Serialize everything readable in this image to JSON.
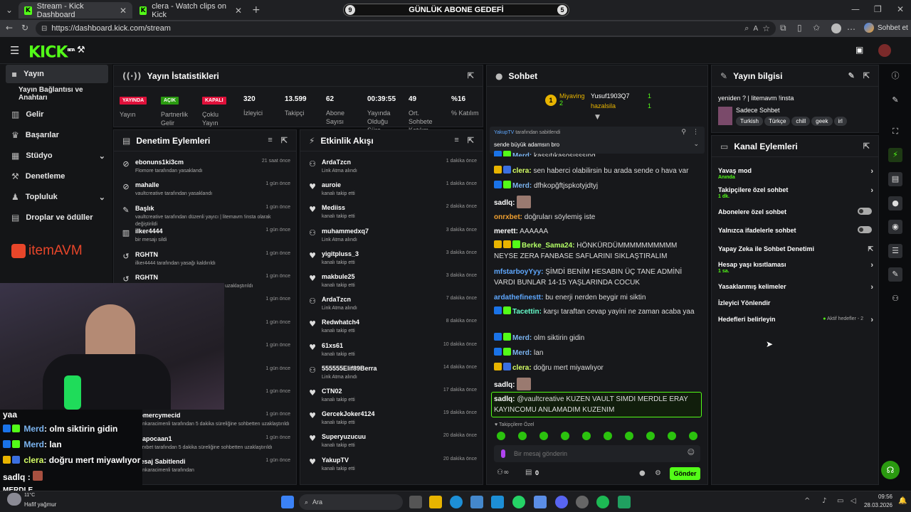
{
  "browser": {
    "tabs": [
      {
        "title": "Stream - Kick Dashboard",
        "active": true
      },
      {
        "title": "clera - Watch clips on Kick",
        "active": false
      }
    ],
    "url": "https://dashboard.kick.com/stream",
    "profile_button": "Sohbet et",
    "goal": {
      "label": "GÜNLÜK ABONE GEDEFİ",
      "left": "9",
      "right": "5"
    }
  },
  "colors": {
    "accent": "#53fc18",
    "live": "#e0103a",
    "bg": "#0b0c0e",
    "panel": "#17181b"
  },
  "topbar": {
    "logo": "KICK",
    "logo_sup": "BETA"
  },
  "sidebar": {
    "items": [
      {
        "label": "Yayın",
        "icon": "broadcast-icon"
      },
      {
        "label": "Yayın Bağlantısı ve Anahtarı",
        "icon": ""
      },
      {
        "label": "Gelir",
        "icon": "chart-icon"
      },
      {
        "label": "Başarılar",
        "icon": "trophy-icon"
      },
      {
        "label": "Stüdyo",
        "icon": "studio-icon"
      },
      {
        "label": "Denetleme",
        "icon": "hammer-icon"
      },
      {
        "label": "Topluluk",
        "icon": "community-icon"
      },
      {
        "label": "Droplar ve ödüller",
        "icon": "gift-icon"
      }
    ],
    "sponsor": "itemAVM"
  },
  "stats": {
    "title": "Yayın İstatistikleri",
    "items": [
      {
        "value": "YAYINDA",
        "label": "Yayın",
        "type": "badge-red"
      },
      {
        "value": "AÇIK",
        "label": "Partnerlik Gelir",
        "type": "badge-green"
      },
      {
        "value": "KAPALI",
        "label": "Çoklu Yayın",
        "type": "badge-red"
      },
      {
        "value": "320",
        "label": "İzleyici"
      },
      {
        "value": "13.599",
        "label": "Takipçi"
      },
      {
        "value": "62",
        "label": "Abone Sayısı"
      },
      {
        "value": "00:39:55",
        "label": "Yayında Olduğu Süre"
      },
      {
        "value": "49",
        "label": "Ort. Sohbete Katılım"
      },
      {
        "value": "%16",
        "label": "% Katılım"
      }
    ]
  },
  "moderation": {
    "title": "Denetim Eylemleri",
    "rows": [
      {
        "icon": "ban-icon",
        "name": "ebonuns1ki3cm",
        "sub": "Flomore tarafından yasaklandı",
        "time": "21 saat önce"
      },
      {
        "icon": "ban-icon",
        "name": "mahalle",
        "sub": "vaultcreative tarafından yasaklandı",
        "time": "1 gün önce"
      },
      {
        "icon": "edit-icon",
        "name": "Başlık",
        "sub": "vaultcreative tarafından düzenli yayıcı | litemavm !insta olarak değiştirildi",
        "time": "1 gün önce"
      },
      {
        "icon": "trash-icon",
        "name": "ilker4444",
        "sub": "bir mesajı sildi",
        "time": "1 gün önce"
      },
      {
        "icon": "undo-icon",
        "name": "RGHTN",
        "sub": "ilker4444 tarafından yasağı kaldırıldı",
        "time": "1 gün önce"
      },
      {
        "icon": "undo-icon",
        "name": "RGHTN",
        "sub": "tarafından 5 dakika süreliğine sohbetten uzaklaştırıldı",
        "time": "1 gün önce"
      },
      {
        "icon": "",
        "name": "",
        "sub": "sohbetten uzaklaştırıldı",
        "time": "1 gün önce"
      },
      {
        "icon": "",
        "name": "",
        "sub": "",
        "time": "1 gün önce"
      },
      {
        "icon": "",
        "name": "",
        "sub": "sohbetten uzaklaştırıldı",
        "time": "1 gün önce"
      },
      {
        "icon": "",
        "name": "",
        "sub": "",
        "time": "1 gün önce"
      },
      {
        "icon": "",
        "name": "",
        "sub": "lldı",
        "time": "1 gün önce"
      },
      {
        "icon": "hourglass-icon",
        "name": "nomercymecid",
        "sub": "erenkaracimenli tarafından 5 dakika süreliğine sohbetten uzaklaştırıldı",
        "time": "1 gün önce"
      },
      {
        "icon": "hourglass-icon",
        "name": "aaapocaan1",
        "sub": "omrxbet tarafından 5 dakika süreliğine sohbetten uzaklaştırıldı",
        "time": "1 gün önce"
      },
      {
        "icon": "pin-icon",
        "name": "Mesaj Sabitlendi",
        "sub": "erenkaracimenli tarafından",
        "time": "1 gün önce"
      }
    ]
  },
  "activity": {
    "title": "Etkinlik Akışı",
    "rows": [
      {
        "icon": "gift-icon",
        "name": "ArdaTzcn",
        "sub": "Link Atma alındı",
        "time": "1 dakika önce",
        "green": true
      },
      {
        "icon": "heart-icon",
        "name": "auroie",
        "sub": "kanalı takip etti",
        "time": "1 dakika önce"
      },
      {
        "icon": "heart-icon",
        "name": "Mediiss",
        "sub": "kanalı takip etti",
        "time": "2 dakika önce"
      },
      {
        "icon": "gift-icon",
        "name": "muhammedxq7",
        "sub": "Link Atma alındı",
        "time": "3 dakika önce",
        "green": true
      },
      {
        "icon": "heart-icon",
        "name": "yigitpluss_3",
        "sub": "kanalı takip etti",
        "time": "3 dakika önce"
      },
      {
        "icon": "heart-icon",
        "name": "makbule25",
        "sub": "kanalı takip etti",
        "time": "3 dakika önce"
      },
      {
        "icon": "gift-icon",
        "name": "ArdaTzcn",
        "sub": "Link Atma alındı",
        "time": "7 dakika önce",
        "green": true
      },
      {
        "icon": "heart-icon",
        "name": "Redwhatch4",
        "sub": "kanalı takip etti",
        "time": "8 dakika önce"
      },
      {
        "icon": "heart-icon",
        "name": "61xs61",
        "sub": "kanalı takip etti",
        "time": "10 dakika önce"
      },
      {
        "icon": "gift-icon",
        "name": "555555Elif89Berra",
        "sub": "Link Atma alındı",
        "time": "14 dakika önce",
        "green": true
      },
      {
        "icon": "heart-icon",
        "name": "CTN02",
        "sub": "kanalı takip etti",
        "time": "17 dakika önce"
      },
      {
        "icon": "heart-icon",
        "name": "GercekJoker4124",
        "sub": "kanalı takip etti",
        "time": "19 dakika önce"
      },
      {
        "icon": "heart-icon",
        "name": "Superyuzucuu",
        "sub": "kanalı takip etti",
        "time": "20 dakika önce"
      },
      {
        "icon": "heart-icon",
        "name": "YakupTV",
        "sub": "kanalı takip etti",
        "time": "20 dakika önce"
      }
    ]
  },
  "chat": {
    "title": "Sohbet",
    "leaderboard": [
      {
        "name": "Miyaving",
        "count": "2"
      },
      {
        "name": "Yusuf1903Q7",
        "count": "1"
      },
      {
        "name": "hazalsila",
        "count": "1"
      }
    ],
    "pinned": {
      "by": "YakupTV",
      "by_suffix": "tarafından sabitlendi",
      "text": "sende büyük adamsın bro"
    },
    "messages": [
      {
        "user": "Merd",
        "color": "#7bb4f0",
        "text": "kaşşıtıkasoşışşşıng",
        "badges": [
          "#1a73e8",
          "#53fc18"
        ]
      },
      {
        "user": "clera",
        "color": "#d6ff66",
        "text": "sen haberci olabilirsin bu arada sende o hava var",
        "badges": [
          "#e8b400",
          "#3b6fe0"
        ]
      },
      {
        "user": "Merd",
        "color": "#7bb4f0",
        "text": "dfhkopğftjspkotyjdtyj",
        "badges": [
          "#1a73e8",
          "#53fc18"
        ]
      },
      {
        "user": "sadlq",
        "color": "#ffffff",
        "text": "",
        "badges": []
      },
      {
        "user": "onrxbet",
        "color": "#f0a030",
        "text": "doğruları söylemiş iste",
        "badges": []
      },
      {
        "user": "merett",
        "color": "#ffffff",
        "text": "AAAAAA",
        "badges": []
      },
      {
        "user": "Berke_Sama24",
        "color": "#b4ff66",
        "text": "HÖNKÜRDÜMMMMMMMMMM NEYSE ZERA FANBASE SAFLARINI SIKLAŞTIRALIM",
        "badges": [
          "#e8b400",
          "#e8b400",
          "#53fc18"
        ]
      },
      {
        "user": "mfstarboyYyy",
        "color": "#5fa8ff",
        "text": "ŞİMDİ BENİM HESABIN ÜÇ TANE ADMİNİ VARDI BUNLAR 14-15 YAŞLARINDA COCUK",
        "badges": []
      },
      {
        "user": "ardathefinestt",
        "color": "#5fa8ff",
        "text": "bu enerji nerden beygir mi siktin",
        "badges": []
      },
      {
        "user": "Tacettin",
        "color": "#66ffcc",
        "text": "karşı taraftan cevap yayini ne zaman acaba yaa",
        "badges": [
          "#1a73e8",
          "#53fc18"
        ]
      },
      {
        "user": "Merd",
        "color": "#7bb4f0",
        "text": "olm siktirin gidin",
        "badges": [
          "#1a73e8",
          "#53fc18"
        ]
      },
      {
        "user": "Merd",
        "color": "#7bb4f0",
        "text": "lan",
        "badges": [
          "#1a73e8",
          "#53fc18"
        ]
      },
      {
        "user": "clera",
        "color": "#d6ff66",
        "text": "doğru mert miyawlıyor",
        "badges": [
          "#e8b400",
          "#3b6fe0"
        ]
      },
      {
        "user": "sadlq",
        "color": "#ffffff",
        "text": "",
        "badges": []
      },
      {
        "user": "sadlq",
        "color": "#ffffff",
        "text": "@vaultcreative KUZEN VAULT SIMDI MERDLE ERAY KAYINCOMU ANLAMADIM KUZENIM",
        "badges": [],
        "highlight": true
      }
    ],
    "mode": "Takipçilere Özel",
    "placeholder": "Bir mesaj gönderin",
    "points": "0",
    "send": "Gönder"
  },
  "info": {
    "title": "Yayın bilgisi",
    "stream_title": "yeniden ? | litemavm !insta",
    "category": "Sadece Sohbet",
    "tags": [
      "Turkish",
      "Türkçe",
      "chill",
      "geek",
      "irl"
    ]
  },
  "channel_actions": {
    "title": "Kanal Eylemleri",
    "items": [
      {
        "label": "Yavaş mod",
        "sub": "Anında",
        "control": "arrow"
      },
      {
        "label": "Takipçilere özel sohbet",
        "sub": "1 dk.",
        "control": "arrow"
      },
      {
        "label": "Abonelere özel sohbet",
        "sub": "",
        "control": "toggle"
      },
      {
        "label": "Yalnızca ifadelerle sohbet",
        "sub": "",
        "control": "toggle"
      },
      {
        "label": "Yapay Zeka ile Sohbet Denetimi",
        "sub": "",
        "control": "external"
      },
      {
        "label": "Hesap yaşı kısıtlaması",
        "sub": "1 sa.",
        "control": "arrow"
      },
      {
        "label": "Yasaklanmış kelimeler",
        "sub": "",
        "control": "arrow"
      },
      {
        "label": "İzleyici Yönlendir",
        "sub": "",
        "control": "none"
      },
      {
        "label": "Hedefleri belirleyin",
        "sub": "",
        "control": "arrow",
        "status": "Aktif hedefler - 2"
      }
    ]
  },
  "overlay": {
    "lines": [
      {
        "user": "",
        "text": "yaa"
      },
      {
        "user": "Merd",
        "text": ": olm siktirin gidin"
      },
      {
        "user": "Merd",
        "text": ": lan"
      },
      {
        "user": "clera",
        "text": ": doğru mert miyawlıyor"
      },
      {
        "user": "sadlq",
        "text": ":"
      }
    ],
    "brand": "MERDLE"
  },
  "taskbar": {
    "weather_temp": "11°C",
    "weather_text": "Hafif yağmur",
    "search": "Ara",
    "time": "09:56",
    "date": "28.03.2026"
  }
}
